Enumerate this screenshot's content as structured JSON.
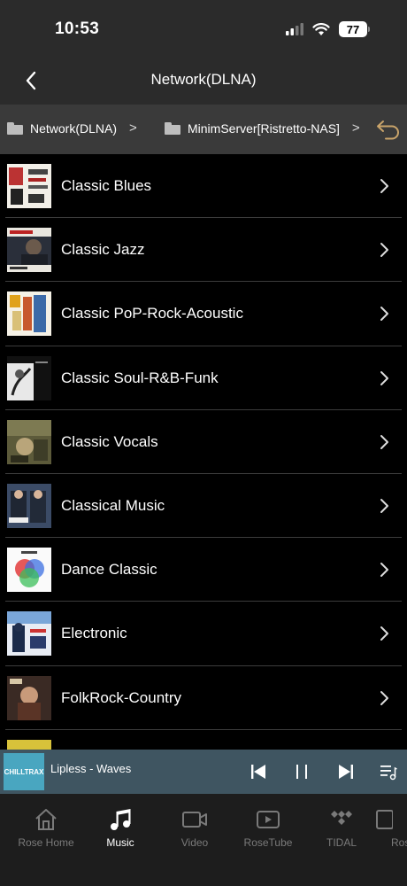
{
  "status": {
    "time": "10:53",
    "battery": "77"
  },
  "nav": {
    "title": "Network(DLNA)"
  },
  "breadcrumb": [
    {
      "label": "Network(DLNA)"
    },
    {
      "label": "MinimServer[Ristretto-NAS]"
    }
  ],
  "list": [
    {
      "label": "Classic Blues",
      "icon": "album-art"
    },
    {
      "label": "Classic Jazz",
      "icon": "album-art"
    },
    {
      "label": "Classic PoP-Rock-Acoustic",
      "icon": "album-art"
    },
    {
      "label": "Classic Soul-R&B-Funk",
      "icon": "album-art"
    },
    {
      "label": "Classic Vocals",
      "icon": "album-art"
    },
    {
      "label": "Classical Music",
      "icon": "album-art"
    },
    {
      "label": "Dance Classic",
      "icon": "album-art"
    },
    {
      "label": "Electronic",
      "icon": "album-art"
    },
    {
      "label": "FolkRock-Country",
      "icon": "album-art"
    }
  ],
  "player": {
    "art_label": "CHILLTRAX",
    "track": "Lipless - Waves"
  },
  "tabs": [
    {
      "label": "Rose Home",
      "icon": "home-icon"
    },
    {
      "label": "Music",
      "icon": "music-note-icon"
    },
    {
      "label": "Video",
      "icon": "video-icon"
    },
    {
      "label": "RoseTube",
      "icon": "play-box-icon"
    },
    {
      "label": "TIDAL",
      "icon": "tidal-icon"
    },
    {
      "label": "Ros",
      "icon": "radio-icon"
    }
  ],
  "colors": {
    "header_bg": "#2b2b2b",
    "breadcrumb_bg": "#3a3a3a",
    "player_bg": "#3f5561",
    "accent_undo": "#c9a46a",
    "tab_active": "#ffffff",
    "tab_inactive": "#7a7a7a"
  }
}
